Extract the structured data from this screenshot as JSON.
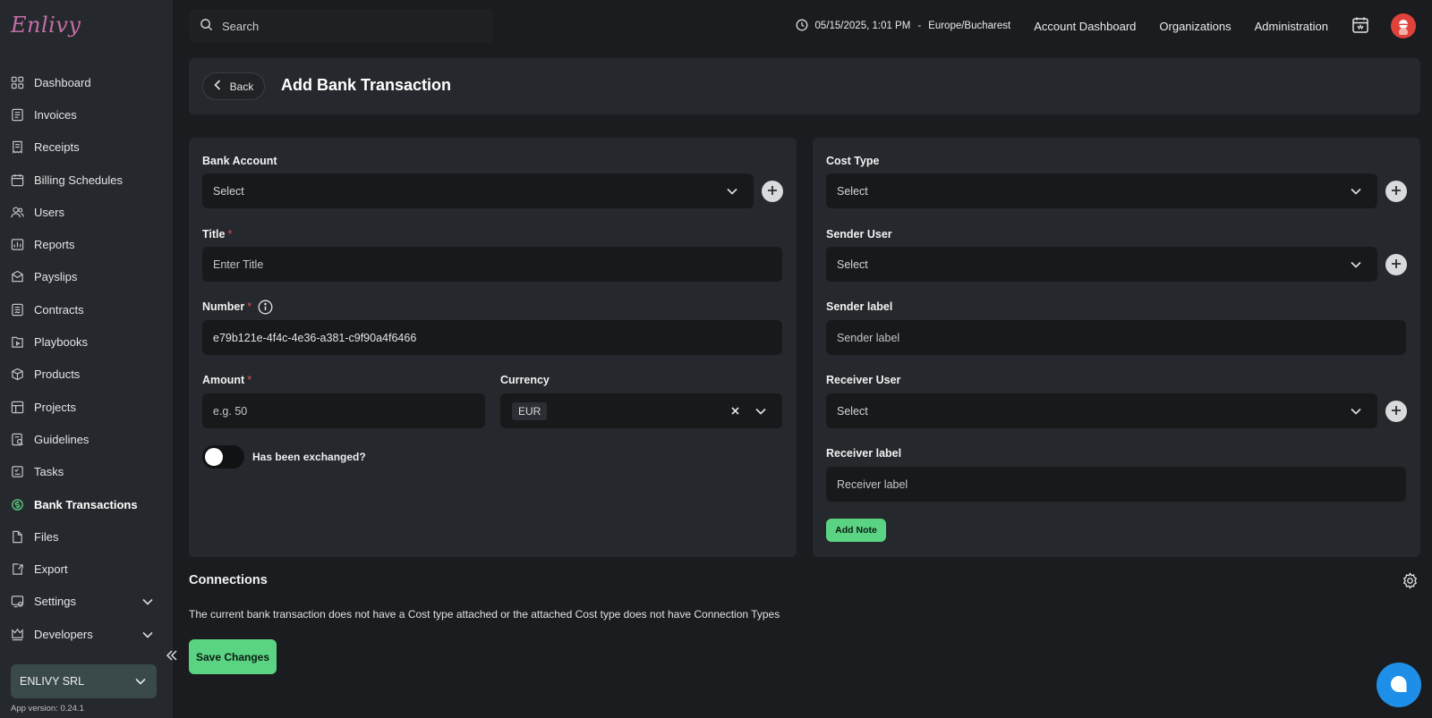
{
  "app": {
    "logo_text": "Enlivy",
    "org_name": "ENLIVY SRL",
    "app_version": "App version: 0.24.1"
  },
  "sidebar": {
    "items": [
      {
        "label": "Dashboard",
        "icon": "dashboard-icon"
      },
      {
        "label": "Invoices",
        "icon": "invoice-icon"
      },
      {
        "label": "Receipts",
        "icon": "receipt-icon"
      },
      {
        "label": "Billing Schedules",
        "icon": "billing-schedule-icon"
      },
      {
        "label": "Users",
        "icon": "users-icon"
      },
      {
        "label": "Reports",
        "icon": "reports-icon"
      },
      {
        "label": "Payslips",
        "icon": "payslip-icon"
      },
      {
        "label": "Contracts",
        "icon": "contract-icon"
      },
      {
        "label": "Playbooks",
        "icon": "playbook-icon"
      },
      {
        "label": "Products",
        "icon": "product-icon"
      },
      {
        "label": "Projects",
        "icon": "project-icon"
      },
      {
        "label": "Guidelines",
        "icon": "guideline-icon"
      },
      {
        "label": "Tasks",
        "icon": "tasks-icon"
      },
      {
        "label": "Bank Transactions",
        "icon": "bank-transaction-icon",
        "active": true
      },
      {
        "label": "Files",
        "icon": "files-icon"
      },
      {
        "label": "Export",
        "icon": "export-icon"
      },
      {
        "label": "Settings",
        "icon": "settings-icon",
        "expandable": true
      },
      {
        "label": "Developers",
        "icon": "developers-icon",
        "expandable": true
      }
    ]
  },
  "topbar": {
    "search_placeholder": "Search",
    "datetime": "05/15/2025, 1:01 PM",
    "separator": "-",
    "timezone": "Europe/Bucharest",
    "links": [
      "Account Dashboard",
      "Organizations",
      "Administration"
    ]
  },
  "page": {
    "back_label": "Back",
    "title": "Add Bank Transaction"
  },
  "form_left": {
    "bank_account": {
      "label": "Bank Account",
      "value": "Select"
    },
    "title": {
      "label": "Title",
      "required_mark": "*",
      "placeholder": "Enter Title"
    },
    "number": {
      "label": "Number",
      "required_mark": "*",
      "value": "e79b121e-4f4c-4e36-a381-c9f90a4f6466"
    },
    "amount": {
      "label": "Amount",
      "required_mark": "*",
      "placeholder": "e.g. 50"
    },
    "currency": {
      "label": "Currency",
      "value": "EUR"
    },
    "exchanged": {
      "label": "Has been exchanged?",
      "checked": false
    }
  },
  "form_right": {
    "cost_type": {
      "label": "Cost Type",
      "value": "Select"
    },
    "sender_user": {
      "label": "Sender User",
      "value": "Select"
    },
    "sender_label": {
      "label": "Sender label",
      "placeholder": "Sender label"
    },
    "receiver_user": {
      "label": "Receiver User",
      "value": "Select"
    },
    "receiver_label": {
      "label": "Receiver label",
      "placeholder": "Receiver label"
    },
    "add_note_label": "Add Note"
  },
  "connections": {
    "title": "Connections",
    "message": "The current bank transaction does not have a Cost type attached or the attached Cost type does not have Connection Types"
  },
  "actions": {
    "save_label": "Save Changes"
  },
  "colors": {
    "accent_green": "#5ad483",
    "chat_blue": "#1e8fe8",
    "required_red": "#e74c4c"
  }
}
